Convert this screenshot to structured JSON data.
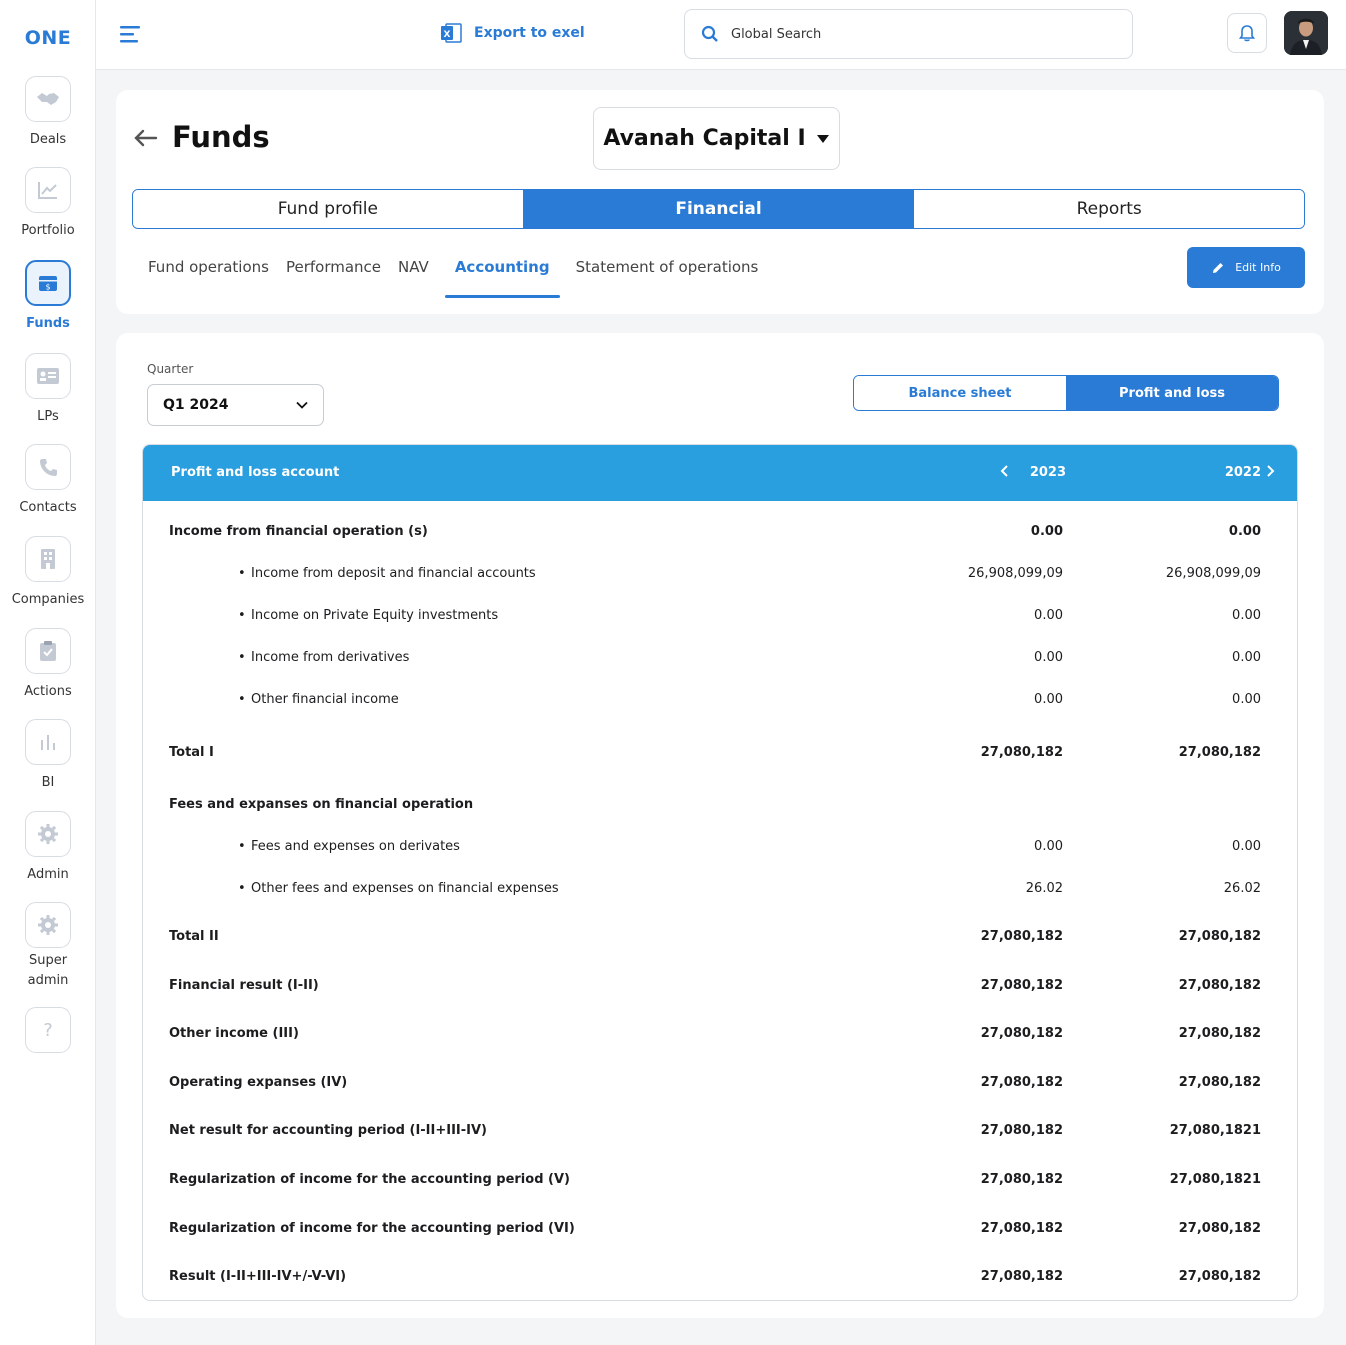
{
  "app": {
    "logo": "ONE"
  },
  "sidebar": {
    "items": [
      {
        "label": "Deals",
        "icon": "handshake-icon"
      },
      {
        "label": "Portfolio",
        "icon": "chart-line-icon"
      },
      {
        "label": "Funds",
        "icon": "money-box-icon",
        "active": true
      },
      {
        "label": "LPs",
        "icon": "id-card-icon"
      },
      {
        "label": "Contacts",
        "icon": "phone-icon"
      },
      {
        "label": "Companies",
        "icon": "building-icon"
      },
      {
        "label": "Actions",
        "icon": "clipboard-check-icon"
      },
      {
        "label": "BI",
        "icon": "bar-chart-icon"
      },
      {
        "label": "Admin",
        "icon": "gear-icon"
      },
      {
        "label": "Super admin",
        "icon": "gear-icon"
      },
      {
        "label": "",
        "icon": "help-icon"
      }
    ]
  },
  "topbar": {
    "export_label": "Export to exel",
    "search_placeholder": "Global Search"
  },
  "header": {
    "title": "Funds",
    "fund_selected": "Avanah Capital I",
    "main_tabs": [
      "Fund profile",
      "Financial",
      "Reports"
    ],
    "active_main_tab": "Financial",
    "sub_tabs": [
      "Fund operations",
      "Performance",
      "NAV",
      "Accounting",
      "Statement of operations"
    ],
    "active_sub_tab": "Accounting",
    "edit_label": "Edit Info"
  },
  "filters": {
    "quarter_label": "Quarter",
    "quarter_value": "Q1 2024",
    "segments": [
      "Balance sheet",
      "Profit and loss"
    ],
    "active_segment": "Profit and loss"
  },
  "table": {
    "title": "Profit and loss account",
    "columns": [
      "2023",
      "2022"
    ],
    "rows": [
      {
        "label": "Income from financial operation (s)",
        "v1": "0.00",
        "v2": "0.00",
        "type": "head"
      },
      {
        "label": "Income from deposit and financial accounts",
        "v1": "26,908,099,09",
        "v2": "26,908,099,09",
        "type": "sub"
      },
      {
        "label": "Income on Private Equity investments",
        "v1": "0.00",
        "v2": "0.00",
        "type": "sub"
      },
      {
        "label": "Income from derivatives",
        "v1": "0.00",
        "v2": "0.00",
        "type": "sub"
      },
      {
        "label": "Other financial income",
        "v1": "0.00",
        "v2": "0.00",
        "type": "sub"
      },
      {
        "label": "Total I",
        "v1": "27,080,182",
        "v2": "27,080,182",
        "type": "total"
      },
      {
        "label": "Fees and expanses on financial operation",
        "v1": "",
        "v2": "",
        "type": "head"
      },
      {
        "label": "Fees and expenses on derivates",
        "v1": "0.00",
        "v2": "0.00",
        "type": "sub"
      },
      {
        "label": "Other fees and expenses on financial expenses",
        "v1": "26.02",
        "v2": "26.02",
        "type": "sub"
      },
      {
        "label": "Total II",
        "v1": "27,080,182",
        "v2": "27,080,182",
        "type": "total"
      },
      {
        "label": "Financial result (I-II)",
        "v1": "27,080,182",
        "v2": "27,080,182",
        "type": "total"
      },
      {
        "label": "Other income (III)",
        "v1": "27,080,182",
        "v2": "27,080,182",
        "type": "total"
      },
      {
        "label": "Operating expanses (IV)",
        "v1": "27,080,182",
        "v2": "27,080,182",
        "type": "total"
      },
      {
        "label": "Net result for accounting period (I-II+III-IV)",
        "v1": "27,080,182",
        "v2": "27,080,1821",
        "type": "total"
      },
      {
        "label": "Regularization of income for the accounting period (V)",
        "v1": "27,080,182",
        "v2": "27,080,1821",
        "type": "total"
      },
      {
        "label": "Regularization of income for the accounting period (VI)",
        "v1": "27,080,182",
        "v2": "27,080,182",
        "type": "total"
      },
      {
        "label": "Result (I-II+III-IV+/-V-VI)",
        "v1": "27,080,182",
        "v2": "27,080,182",
        "type": "total"
      }
    ]
  },
  "colors": {
    "accent": "#2a7bd6",
    "table_header": "#2a9fe0"
  }
}
